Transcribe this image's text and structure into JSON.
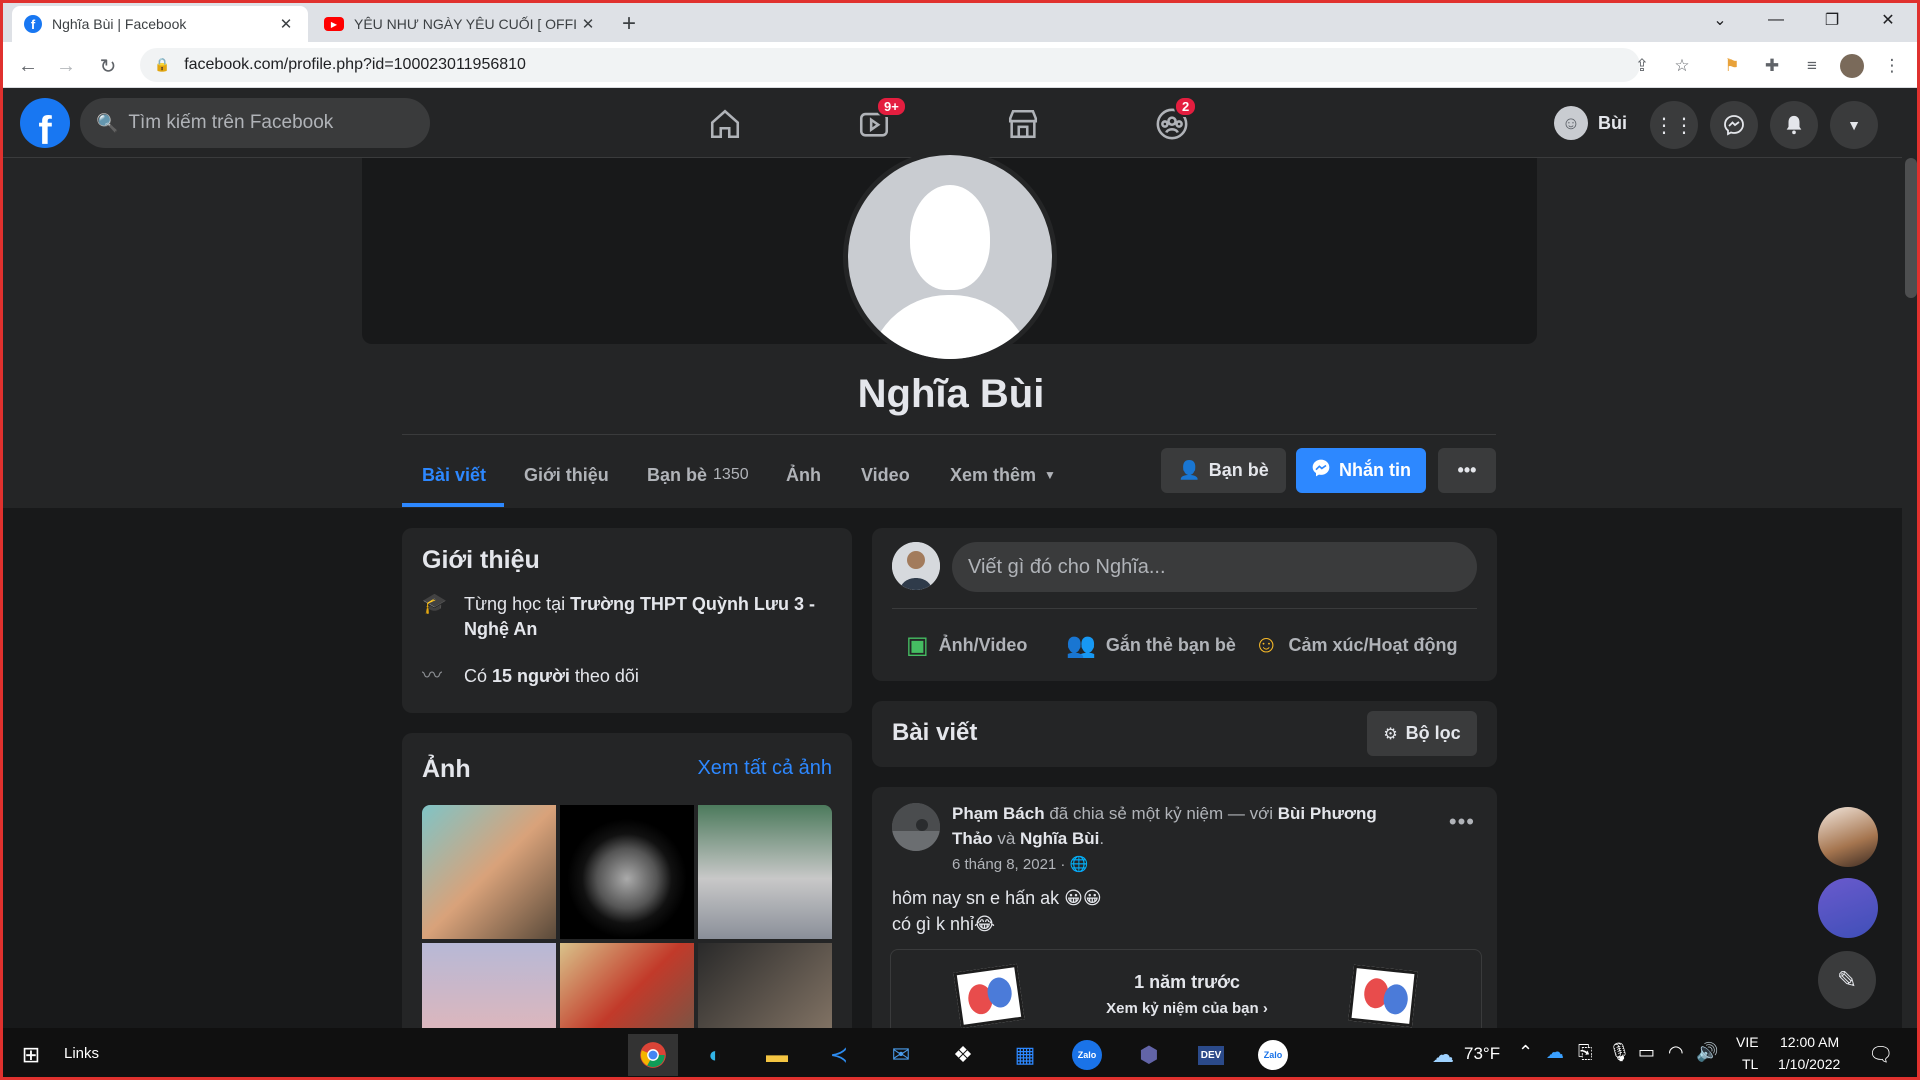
{
  "browser": {
    "tabs": [
      {
        "title": "Nghĩa Bùi | Facebook",
        "active": true
      },
      {
        "title": "YÊU NHƯ NGÀY YÊU CUỐI [ OFFI",
        "active": false
      }
    ],
    "url": "facebook.com/profile.php?id=100023011956810"
  },
  "fb": {
    "search_placeholder": "Tìm kiếm trên Facebook",
    "badges": {
      "watch": "9+",
      "groups": "2"
    },
    "nav_user": "Bùi"
  },
  "profile": {
    "name": "Nghĩa Bùi",
    "tabs": [
      "Bài viết",
      "Giới thiệu",
      "Bạn bè",
      "Ảnh",
      "Video",
      "Xem thêm"
    ],
    "friends_count": "1350",
    "buttons": {
      "friends": "Bạn bè",
      "message": "Nhắn tin"
    }
  },
  "intro": {
    "title": "Giới thiệu",
    "school_prefix": "Từng học tại ",
    "school_name": "Trường THPT Quỳnh Lưu 3 - Nghệ An",
    "followers_prefix": "Có ",
    "followers_bold": "15 người",
    "followers_suffix": " theo dõi"
  },
  "photos": {
    "title": "Ảnh",
    "see_all": "Xem tất cả ảnh"
  },
  "composer": {
    "placeholder": "Viết gì đó cho Nghĩa...",
    "actions": [
      "Ảnh/Video",
      "Gắn thẻ bạn bè",
      "Cảm xúc/Hoạt động"
    ]
  },
  "posts_header": {
    "title": "Bài viết",
    "filter": "Bộ lọc"
  },
  "post": {
    "author": "Phạm Bách",
    "action": " đã chia sẻ một kỷ niệm — với ",
    "with1": "Bùi Phương Thảo",
    "and": " và ",
    "with2": "Nghĩa Bùi",
    "period": ".",
    "date": "6 tháng 8, 2021 · ",
    "line1": "hôm nay sn e hấn ak 😀😀",
    "line2": "có gì k nhỉ😂",
    "memory_title": "1 năm trước",
    "memory_sub": "Xem kỷ niệm của bạn"
  },
  "taskbar": {
    "links": "Links",
    "weather": "73°F",
    "lang1": "VIE",
    "lang2": "TL",
    "time": "12:00 AM",
    "date": "1/10/2022"
  },
  "colors": {
    "fb_blue": "#1877f2",
    "accent": "#2d88ff",
    "dark_bg": "#18191a",
    "card_bg": "#242526"
  }
}
